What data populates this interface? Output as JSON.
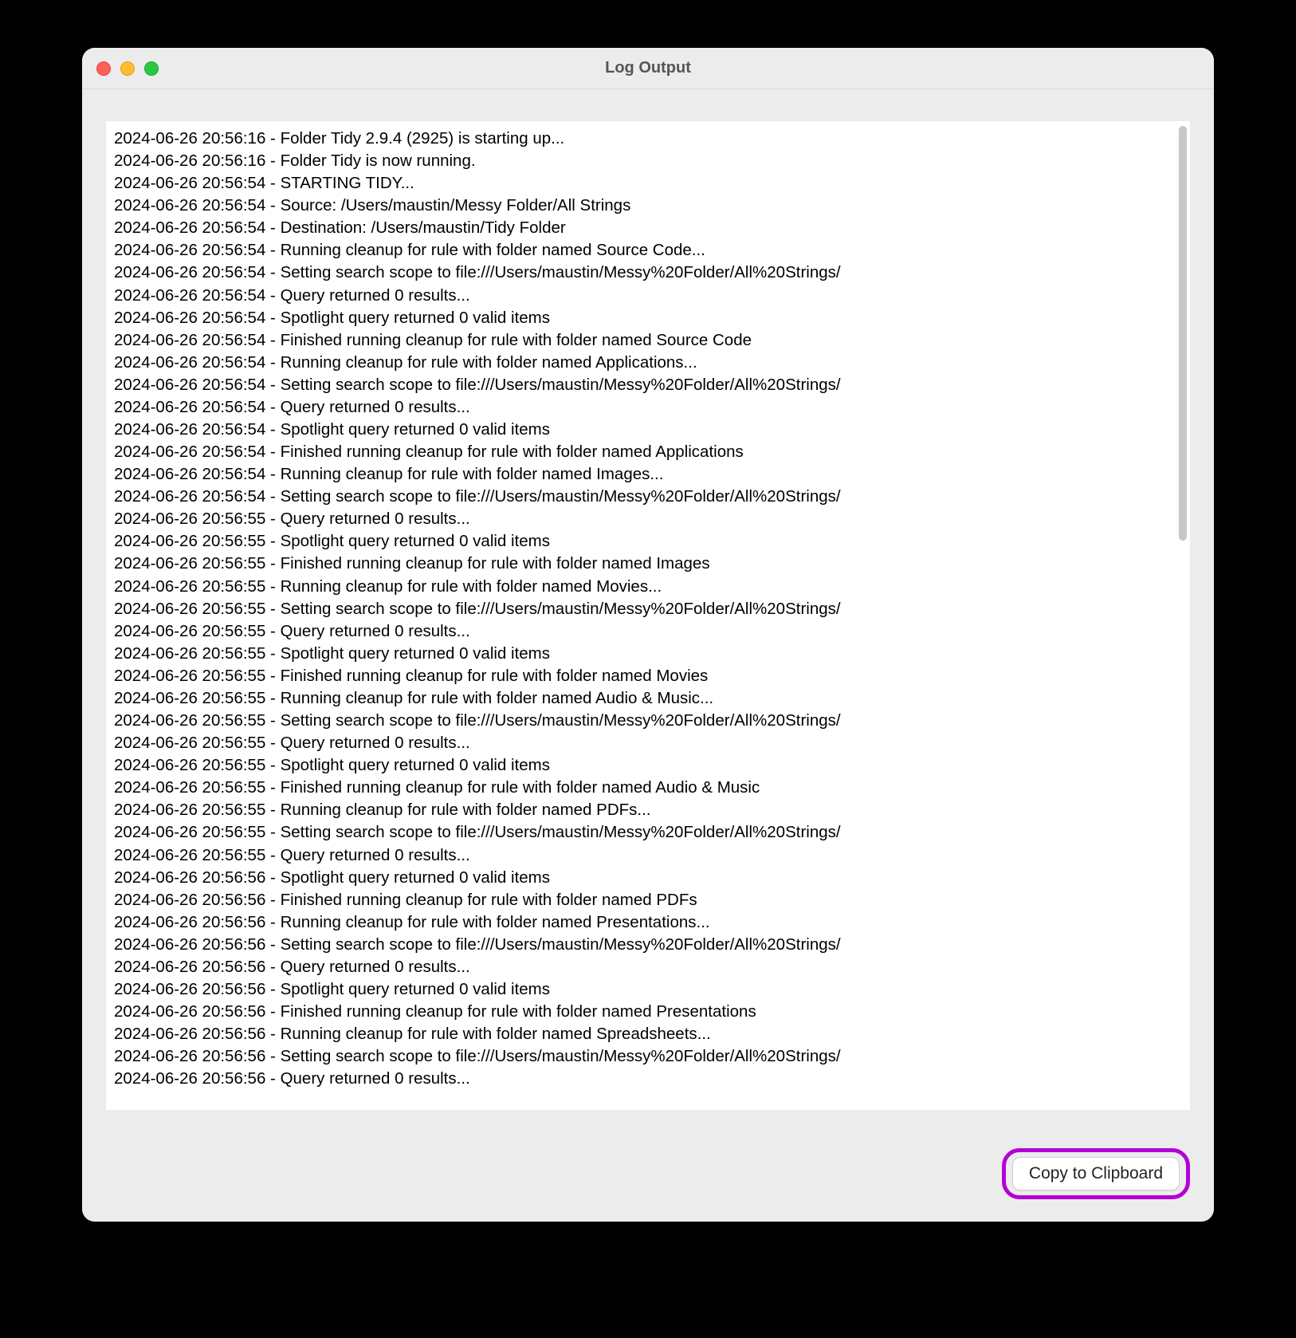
{
  "window": {
    "title": "Log Output"
  },
  "footer": {
    "copy_label": "Copy to Clipboard"
  },
  "log": {
    "lines": [
      "2024-06-26 20:56:16 - Folder Tidy 2.9.4 (2925) is starting up...",
      "2024-06-26 20:56:16 - Folder Tidy is now running.",
      "2024-06-26 20:56:54 - STARTING TIDY...",
      "2024-06-26 20:56:54 - Source: /Users/maustin/Messy Folder/All Strings",
      "2024-06-26 20:56:54 - Destination: /Users/maustin/Tidy Folder",
      "2024-06-26 20:56:54 - Running cleanup for rule with folder named Source Code...",
      "2024-06-26 20:56:54 - Setting search scope to file:///Users/maustin/Messy%20Folder/All%20Strings/",
      "2024-06-26 20:56:54 - Query returned 0 results...",
      "2024-06-26 20:56:54 - Spotlight query returned 0 valid items",
      "2024-06-26 20:56:54 - Finished running cleanup for rule with folder named Source Code",
      "2024-06-26 20:56:54 - Running cleanup for rule with folder named Applications...",
      "2024-06-26 20:56:54 - Setting search scope to file:///Users/maustin/Messy%20Folder/All%20Strings/",
      "2024-06-26 20:56:54 - Query returned 0 results...",
      "2024-06-26 20:56:54 - Spotlight query returned 0 valid items",
      "2024-06-26 20:56:54 - Finished running cleanup for rule with folder named Applications",
      "2024-06-26 20:56:54 - Running cleanup for rule with folder named Images...",
      "2024-06-26 20:56:54 - Setting search scope to file:///Users/maustin/Messy%20Folder/All%20Strings/",
      "2024-06-26 20:56:55 - Query returned 0 results...",
      "2024-06-26 20:56:55 - Spotlight query returned 0 valid items",
      "2024-06-26 20:56:55 - Finished running cleanup for rule with folder named Images",
      "2024-06-26 20:56:55 - Running cleanup for rule with folder named Movies...",
      "2024-06-26 20:56:55 - Setting search scope to file:///Users/maustin/Messy%20Folder/All%20Strings/",
      "2024-06-26 20:56:55 - Query returned 0 results...",
      "2024-06-26 20:56:55 - Spotlight query returned 0 valid items",
      "2024-06-26 20:56:55 - Finished running cleanup for rule with folder named Movies",
      "2024-06-26 20:56:55 - Running cleanup for rule with folder named Audio & Music...",
      "2024-06-26 20:56:55 - Setting search scope to file:///Users/maustin/Messy%20Folder/All%20Strings/",
      "2024-06-26 20:56:55 - Query returned 0 results...",
      "2024-06-26 20:56:55 - Spotlight query returned 0 valid items",
      "2024-06-26 20:56:55 - Finished running cleanup for rule with folder named Audio & Music",
      "2024-06-26 20:56:55 - Running cleanup for rule with folder named PDFs...",
      "2024-06-26 20:56:55 - Setting search scope to file:///Users/maustin/Messy%20Folder/All%20Strings/",
      "2024-06-26 20:56:55 - Query returned 0 results...",
      "2024-06-26 20:56:56 - Spotlight query returned 0 valid items",
      "2024-06-26 20:56:56 - Finished running cleanup for rule with folder named PDFs",
      "2024-06-26 20:56:56 - Running cleanup for rule with folder named Presentations...",
      "2024-06-26 20:56:56 - Setting search scope to file:///Users/maustin/Messy%20Folder/All%20Strings/",
      "2024-06-26 20:56:56 - Query returned 0 results...",
      "2024-06-26 20:56:56 - Spotlight query returned 0 valid items",
      "2024-06-26 20:56:56 - Finished running cleanup for rule with folder named Presentations",
      "2024-06-26 20:56:56 - Running cleanup for rule with folder named Spreadsheets...",
      "2024-06-26 20:56:56 - Setting search scope to file:///Users/maustin/Messy%20Folder/All%20Strings/",
      "2024-06-26 20:56:56 - Query returned 0 results..."
    ]
  }
}
